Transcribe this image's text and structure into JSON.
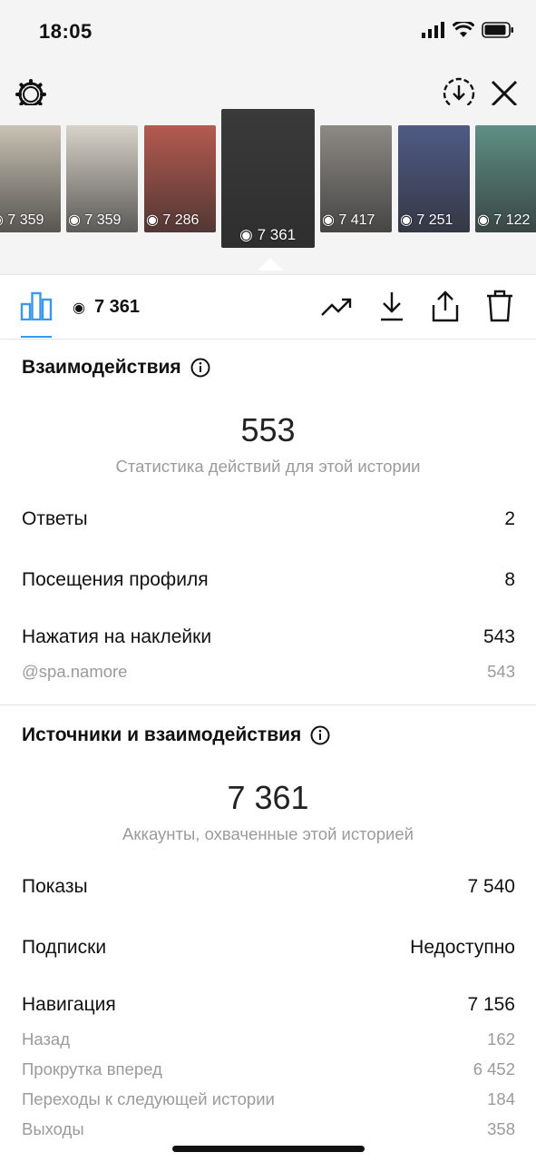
{
  "status": {
    "time": "18:05"
  },
  "carousel": {
    "thumbs": [
      {
        "views": "7 359",
        "bg": "#c9c2b4"
      },
      {
        "views": "7 359",
        "bg": "#d8d3c9"
      },
      {
        "views": "7 286",
        "bg": "#b55a4f"
      },
      {
        "views": "7 361",
        "bg": "#3a3a3a"
      },
      {
        "views": "7 417",
        "bg": "#8d8a85"
      },
      {
        "views": "7 251",
        "bg": "#4f5b86"
      },
      {
        "views": "7 122",
        "bg": "#5f8f84"
      }
    ]
  },
  "tab": {
    "views": "7 361"
  },
  "interactions": {
    "title": "Взаимодействия",
    "total": "553",
    "caption": "Статистика действий для этой истории",
    "rows": [
      {
        "label": "Ответы",
        "value": "2"
      },
      {
        "label": "Посещения профиля",
        "value": "8"
      },
      {
        "label": "Нажатия на наклейки",
        "value": "543"
      }
    ],
    "sub_rows": [
      {
        "label": "@spa.namore",
        "value": "543"
      }
    ]
  },
  "sources": {
    "title": "Источники и взаимодействия",
    "total": "7 361",
    "caption": "Аккаунты, охваченные этой историей",
    "rows": [
      {
        "label": "Показы",
        "value": "7 540"
      },
      {
        "label": "Подписки",
        "value": "Недоступно"
      },
      {
        "label": "Навигация",
        "value": "7 156"
      }
    ],
    "sub_rows": [
      {
        "label": "Назад",
        "value": "162"
      },
      {
        "label": "Прокрутка вперед",
        "value": "6 452"
      },
      {
        "label": "Переходы к следующей истории",
        "value": "184"
      },
      {
        "label": "Выходы",
        "value": "358"
      }
    ]
  },
  "colors": {
    "accent": "#3897f0"
  }
}
